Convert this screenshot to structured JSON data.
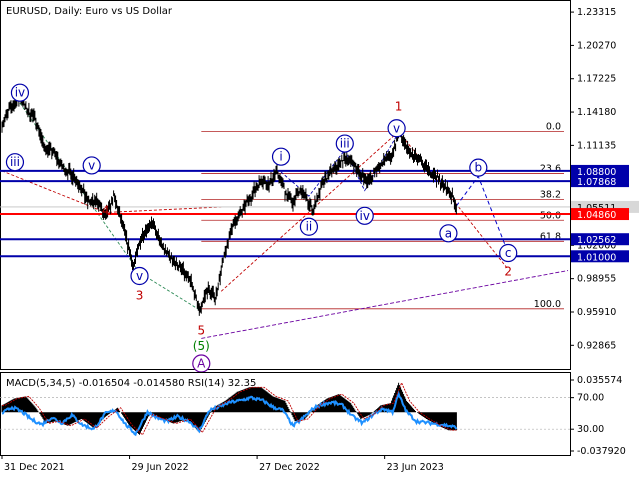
{
  "chart_data": [
    {
      "type": "candlestick",
      "title": "EURUSD, Daily:  Euro vs US Dollar",
      "symbol": "EURUSD",
      "timeframe": "Daily",
      "y_ticks": [
        "1.23315",
        "1.20270",
        "1.17225",
        "1.14180",
        "1.11135",
        "1.08090",
        "1.05045",
        "1.02000",
        "0.98955",
        "0.95910",
        "0.92865"
      ],
      "ylim": [
        0.907,
        1.2442
      ],
      "x_ticks": [
        {
          "label": "31 Dec 2021",
          "index": 0
        },
        {
          "label": "29 Jun 2022",
          "index": 128
        },
        {
          "label": "27 Dec 2022",
          "index": 256
        },
        {
          "label": "23 Jun 2023",
          "index": 384
        }
      ],
      "series_anchors": [
        [
          0,
          1.13
        ],
        [
          8,
          1.145
        ],
        [
          18,
          1.155
        ],
        [
          26,
          1.143
        ],
        [
          34,
          1.135
        ],
        [
          42,
          1.11
        ],
        [
          52,
          1.105
        ],
        [
          62,
          1.09
        ],
        [
          74,
          1.082
        ],
        [
          86,
          1.06
        ],
        [
          96,
          1.06
        ],
        [
          104,
          1.045
        ],
        [
          112,
          1.065
        ],
        [
          122,
          1.035
        ],
        [
          132,
          1.0
        ],
        [
          140,
          1.028
        ],
        [
          150,
          1.042
        ],
        [
          160,
          1.02
        ],
        [
          170,
          1.008
        ],
        [
          180,
          0.998
        ],
        [
          190,
          0.986
        ],
        [
          198,
          0.96
        ],
        [
          206,
          0.98
        ],
        [
          214,
          0.972
        ],
        [
          222,
          1.005
        ],
        [
          230,
          1.035
        ],
        [
          240,
          1.05
        ],
        [
          250,
          1.065
        ],
        [
          260,
          1.08
        ],
        [
          268,
          1.075
        ],
        [
          276,
          1.088
        ],
        [
          284,
          1.07
        ],
        [
          292,
          1.06
        ],
        [
          300,
          1.07
        ],
        [
          306,
          1.062
        ],
        [
          312,
          1.052
        ],
        [
          320,
          1.072
        ],
        [
          328,
          1.085
        ],
        [
          336,
          1.092
        ],
        [
          344,
          1.1
        ],
        [
          352,
          1.095
        ],
        [
          360,
          1.085
        ],
        [
          368,
          1.078
        ],
        [
          376,
          1.09
        ],
        [
          384,
          1.098
        ],
        [
          392,
          1.101
        ],
        [
          398,
          1.124
        ],
        [
          404,
          1.112
        ],
        [
          410,
          1.104
        ],
        [
          418,
          1.098
        ],
        [
          426,
          1.09
        ],
        [
          434,
          1.085
        ],
        [
          442,
          1.075
        ],
        [
          450,
          1.068
        ],
        [
          456,
          1.056
        ]
      ],
      "current_price": "1.05511",
      "horizontal_levels": [
        {
          "price": 1.088,
          "label": "1.08800",
          "color": "#0000aa"
        },
        {
          "price": 1.0787,
          "label": "1.07868",
          "color": "#0000aa"
        },
        {
          "price": 1.0486,
          "label": "1.04860",
          "color": "#ff0000"
        },
        {
          "price": 1.0256,
          "label": "1.02562",
          "color": "#0000aa"
        },
        {
          "price": 1.01,
          "label": "1.01000",
          "color": "#0000aa"
        }
      ],
      "fibonacci_levels": [
        {
          "label": "0.0",
          "price": 1.124
        },
        {
          "label": "23.6",
          "price": 1.0857
        },
        {
          "label": "38.2",
          "price": 1.062
        },
        {
          "label": "50.0",
          "price": 1.0429
        },
        {
          "label": "61.8",
          "price": 1.0237
        },
        {
          "label": "100.0",
          "price": 0.962
        }
      ],
      "wave_labels": [
        {
          "text": "iv",
          "index": 18,
          "price": 1.1595,
          "style": "circle",
          "color": "#0000aa"
        },
        {
          "text": "iii",
          "index": 13,
          "price": 1.096,
          "style": "circle",
          "color": "#0000aa"
        },
        {
          "text": "v",
          "index": 90,
          "price": 1.093,
          "style": "circle",
          "color": "#0000aa"
        },
        {
          "text": "4",
          "index": 104,
          "price": 1.052,
          "style": "plain",
          "color": "#c00000"
        },
        {
          "text": "v",
          "index": 138,
          "price": 0.992,
          "style": "circle",
          "color": "#0000aa"
        },
        {
          "text": "3",
          "index": 138,
          "price": 0.974,
          "style": "plain",
          "color": "#c00000"
        },
        {
          "text": "5",
          "index": 200,
          "price": 0.942,
          "style": "plain",
          "color": "#c00000"
        },
        {
          "text": "(5)",
          "index": 200,
          "price": 0.928,
          "style": "plain",
          "color": "#008000"
        },
        {
          "text": "A",
          "index": 200,
          "price": 0.912,
          "style": "circle",
          "color": "#6a00a0"
        },
        {
          "text": "i",
          "index": 280,
          "price": 1.101,
          "style": "circle",
          "color": "#0000aa"
        },
        {
          "text": "ii",
          "index": 308,
          "price": 1.037,
          "style": "circle",
          "color": "#0000aa"
        },
        {
          "text": "iii",
          "index": 344,
          "price": 1.113,
          "style": "circle",
          "color": "#0000aa"
        },
        {
          "text": "iv",
          "index": 364,
          "price": 1.047,
          "style": "circle",
          "color": "#0000aa"
        },
        {
          "text": "1",
          "index": 398,
          "price": 1.147,
          "style": "plain",
          "color": "#c00000"
        },
        {
          "text": "v",
          "index": 396,
          "price": 1.127,
          "style": "circle",
          "color": "#0000aa"
        },
        {
          "text": "b",
          "index": 478,
          "price": 1.091,
          "style": "circle",
          "color": "#0000aa"
        },
        {
          "text": "a",
          "index": 448,
          "price": 1.031,
          "style": "circle",
          "color": "#0000aa"
        },
        {
          "text": "c",
          "index": 508,
          "price": 1.013,
          "style": "circle",
          "color": "#0000aa"
        },
        {
          "text": "2",
          "index": 508,
          "price": 0.996,
          "style": "plain",
          "color": "#c00000"
        }
      ],
      "forecast_path": [
        [
          456,
          1.056
        ],
        [
          478,
          1.083
        ],
        [
          508,
          1.013
        ]
      ],
      "fib_start_index": 200,
      "fib_end_index": 564
    },
    {
      "type": "histogram",
      "title": "MACD(5,34,5) -0.016504 -0.014580 RSI(14) 32.35",
      "y_ticks_right": [
        "0.035574",
        "70.00",
        "30.00",
        "-0.037920"
      ],
      "macd_anchors": [
        [
          0,
          0.006
        ],
        [
          12,
          0.012
        ],
        [
          24,
          0.014
        ],
        [
          34,
          0.004
        ],
        [
          44,
          -0.01
        ],
        [
          54,
          -0.008
        ],
        [
          66,
          -0.012
        ],
        [
          80,
          -0.006
        ],
        [
          92,
          -0.014
        ],
        [
          104,
          -0.004
        ],
        [
          116,
          0.004
        ],
        [
          128,
          -0.012
        ],
        [
          138,
          -0.02
        ],
        [
          148,
          -0.002
        ],
        [
          160,
          -0.006
        ],
        [
          172,
          -0.01
        ],
        [
          186,
          -0.006
        ],
        [
          198,
          -0.018
        ],
        [
          212,
          0.004
        ],
        [
          224,
          0.01
        ],
        [
          236,
          0.018
        ],
        [
          248,
          0.022
        ],
        [
          260,
          0.022
        ],
        [
          272,
          0.014
        ],
        [
          284,
          0.01
        ],
        [
          294,
          -0.008
        ],
        [
          304,
          -0.006
        ],
        [
          316,
          0.006
        ],
        [
          326,
          0.012
        ],
        [
          338,
          0.016
        ],
        [
          350,
          0.008
        ],
        [
          360,
          -0.006
        ],
        [
          370,
          -0.002
        ],
        [
          380,
          0.006
        ],
        [
          390,
          0.008
        ],
        [
          398,
          0.026
        ],
        [
          406,
          0.01
        ],
        [
          416,
          0.0
        ],
        [
          426,
          -0.006
        ],
        [
          438,
          -0.012
        ],
        [
          448,
          -0.016
        ],
        [
          456,
          -0.016
        ]
      ],
      "rsi_anchors": [
        [
          0,
          50
        ],
        [
          10,
          58
        ],
        [
          20,
          52
        ],
        [
          30,
          42
        ],
        [
          40,
          36
        ],
        [
          50,
          45
        ],
        [
          60,
          38
        ],
        [
          70,
          48
        ],
        [
          80,
          36
        ],
        [
          92,
          30
        ],
        [
          104,
          50
        ],
        [
          114,
          54
        ],
        [
          124,
          36
        ],
        [
          134,
          24
        ],
        [
          146,
          52
        ],
        [
          156,
          44
        ],
        [
          166,
          40
        ],
        [
          176,
          46
        ],
        [
          188,
          40
        ],
        [
          198,
          28
        ],
        [
          208,
          54
        ],
        [
          218,
          58
        ],
        [
          228,
          64
        ],
        [
          238,
          66
        ],
        [
          250,
          70
        ],
        [
          262,
          66
        ],
        [
          272,
          58
        ],
        [
          282,
          54
        ],
        [
          292,
          34
        ],
        [
          302,
          44
        ],
        [
          312,
          56
        ],
        [
          322,
          62
        ],
        [
          332,
          64
        ],
        [
          342,
          60
        ],
        [
          352,
          46
        ],
        [
          362,
          38
        ],
        [
          372,
          48
        ],
        [
          382,
          56
        ],
        [
          392,
          52
        ],
        [
          398,
          74
        ],
        [
          406,
          52
        ],
        [
          416,
          40
        ],
        [
          428,
          38
        ],
        [
          440,
          36
        ],
        [
          450,
          34
        ],
        [
          456,
          32
        ]
      ]
    }
  ]
}
